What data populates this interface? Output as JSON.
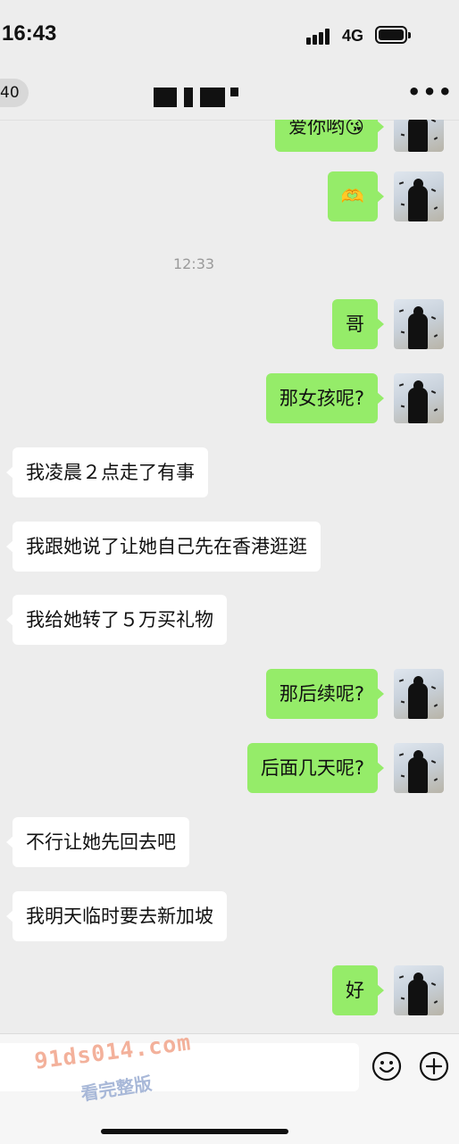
{
  "status_bar": {
    "time": "16:43",
    "network": "4G"
  },
  "nav": {
    "back_count": "40",
    "more": "•••"
  },
  "messages": [
    {
      "side": "out",
      "text": "爱你哟😘"
    },
    {
      "side": "out",
      "text": "🫶"
    },
    {
      "type": "time",
      "text": "12:33"
    },
    {
      "side": "out",
      "text": "哥"
    },
    {
      "side": "out",
      "text": "那女孩呢?"
    },
    {
      "side": "in",
      "text": "我凌晨２点走了有事"
    },
    {
      "side": "in",
      "text": "我跟她说了让她自己先在香港逛逛"
    },
    {
      "side": "in",
      "text": "我给她转了５万买礼物"
    },
    {
      "side": "out",
      "text": "那后续呢?"
    },
    {
      "side": "out",
      "text": "后面几天呢?"
    },
    {
      "side": "in",
      "text": "不行让她先回去吧"
    },
    {
      "side": "in",
      "text": "我明天临时要去新加坡"
    },
    {
      "side": "out",
      "text": "好"
    }
  ],
  "input_bar": {
    "emoji_icon": "smiley-icon",
    "plus_icon": "plus-circle-icon"
  },
  "watermark": {
    "site": "91ds014.com",
    "caption": "看完整版"
  },
  "colors": {
    "background": "#ededed",
    "outgoing_bubble": "#95ec69",
    "incoming_bubble": "#ffffff"
  }
}
